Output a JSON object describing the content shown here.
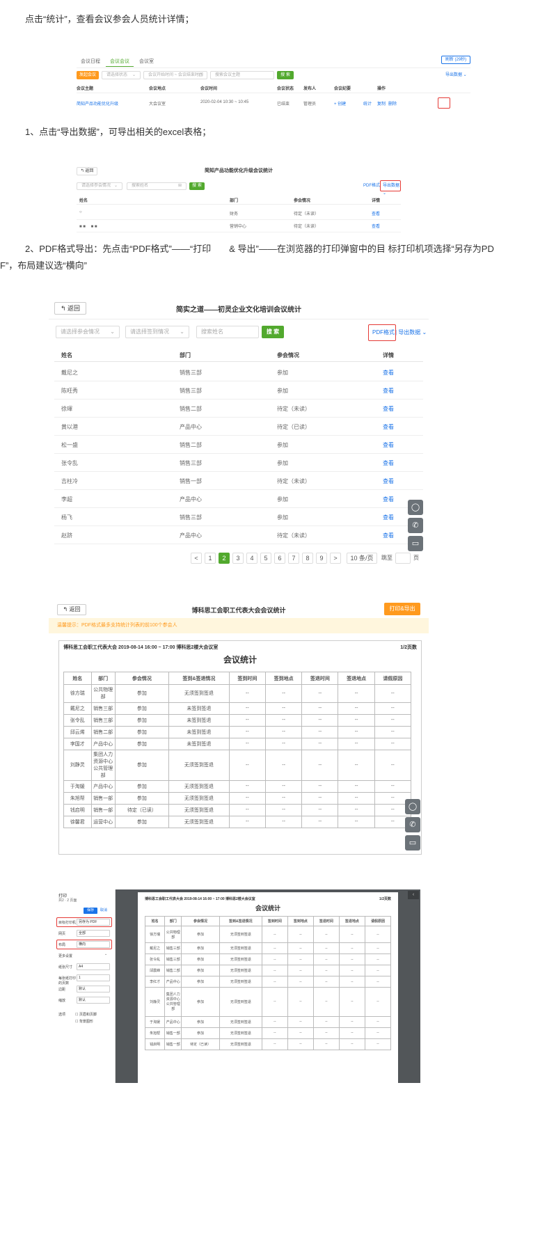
{
  "paragraphs": {
    "p1": "点击“统计”，查看会议参会人员统计详情；",
    "p2": "1、点击“导出数据”，可导出相关的excel表格；",
    "p3a": "2、PDF格式导出：先点击“PDF格式”——“打印　　& 导出”——在浏览器的打印弹窗中的目 标打印机项选择“另存为PD",
    "p3b": "F”，布局建议选“横向”"
  },
  "shot1": {
    "tabs": [
      "会议日程",
      "会议会议",
      "会议室"
    ],
    "refresh": "刷新 (29秒)",
    "add_btn": "发起会议",
    "status_placeholder": "请选择状态",
    "date_placeholder": "会议开始时间 ~ 会议结束时间",
    "search_placeholder": "搜索会议主题",
    "search_btn": "搜 索",
    "export": "导出数据",
    "headers": [
      "会议主题",
      "会议地点",
      "会议时间",
      "会议状态",
      "发布人",
      "会议纪要",
      "操作"
    ],
    "row": {
      "topic": "简知产品功能优化升级",
      "place": "大会议室",
      "time": "2020-02-04 10:30 ~ 10:45",
      "status": "已结束",
      "publisher": "管理员",
      "minutes": "+ 创建",
      "op1": "统计",
      "op2": "复制",
      "op3": "删除"
    }
  },
  "shot2": {
    "back": "返回",
    "title": "简知产品功能优化升级会议统计",
    "sel1": "请选择参会情况",
    "search_placeholder": "搜索姓名",
    "search_btn": "搜 索",
    "pdf": "PDF格式",
    "export": "导出数据",
    "headers": [
      "姓名",
      "部门",
      "参会情况",
      "详情"
    ],
    "rows": [
      {
        "name": "○",
        "dept": "财务",
        "status": "待定（未读）",
        "detail": "查看"
      },
      {
        "name": "■ ■ 　■ ■",
        "dept": "营销中心",
        "status": "待定（未读）",
        "detail": "查看"
      }
    ]
  },
  "shot3": {
    "back": "返回",
    "title": "简实之道——初灵企业文化培训会议统计",
    "sel1": "请选择参会情况",
    "sel2": "请选择签到情况",
    "search_placeholder": "搜索姓名",
    "search_btn": "搜 索",
    "pdf": "PDF格式",
    "export": "导出数据",
    "headers": [
      "姓名",
      "部门",
      "参会情况",
      "详情"
    ],
    "rows": [
      {
        "name": "戴尼之",
        "dept": "销售三部",
        "status": "参加",
        "detail": "查看"
      },
      {
        "name": "陈旺秀",
        "dept": "销售三部",
        "status": "参加",
        "detail": "查看"
      },
      {
        "name": "徐琿",
        "dept": "销售二部",
        "status": "待定（未读）",
        "detail": "查看"
      },
      {
        "name": "黄以港",
        "dept": "产品中心",
        "status": "待定（已读）",
        "detail": "查看"
      },
      {
        "name": "松一盛",
        "dept": "销售二部",
        "status": "参加",
        "detail": "查看"
      },
      {
        "name": "张令乱",
        "dept": "销售三部",
        "status": "参加",
        "detail": "查看"
      },
      {
        "name": "吉柱冷",
        "dept": "销售一部",
        "status": "待定（未读）",
        "detail": "查看"
      },
      {
        "name": "李超",
        "dept": "产品中心",
        "status": "参加",
        "detail": "查看"
      },
      {
        "name": "杨飞",
        "dept": "销售三部",
        "status": "参加",
        "detail": "查看"
      },
      {
        "name": "赵跻",
        "dept": "产品中心",
        "status": "待定（未读）",
        "detail": "查看"
      }
    ],
    "pages": [
      "1",
      "2",
      "3",
      "4",
      "5",
      "6",
      "7",
      "8",
      "9"
    ],
    "prev": "<",
    "next": ">",
    "page_size": "10 条/页",
    "goto": "跳至",
    "page_unit": "页"
  },
  "shot4": {
    "back": "返回",
    "title": "博科思工会职工代表大会会议统计",
    "print_btn": "打印&导出",
    "notice": "温馨提示：PDF格式最多支持统计列表的前100个参会人",
    "meta": "博科思工会职工代表大会 2019-08-14 16:00 ~ 17:00 博科思2楼大会议室",
    "pageinfo": "1/2页数",
    "table_title": "会议统计",
    "headers": [
      "姓名",
      "部门",
      "参会情况",
      "签到&签退情况",
      "签到时间",
      "签到地点",
      "签退时间",
      "签退地点",
      "请假原因"
    ],
    "rows": [
      {
        "name": "徐方瑞",
        "dept": "公共物理部",
        "status": "参加",
        "sign": "无须签到签退",
        "c5": "--",
        "c6": "--",
        "c7": "--",
        "c8": "--",
        "c9": "--"
      },
      {
        "name": "戴尼之",
        "dept": "销售三部",
        "status": "参加",
        "sign": "未签到签退",
        "c5": "--",
        "c6": "--",
        "c7": "--",
        "c8": "--",
        "c9": "--"
      },
      {
        "name": "张令乱",
        "dept": "销售三部",
        "status": "参加",
        "sign": "未签到签退",
        "c5": "--",
        "c6": "--",
        "c7": "--",
        "c8": "--",
        "c9": "--"
      },
      {
        "name": "邱云烯",
        "dept": "销售二部",
        "status": "参加",
        "sign": "未签到签退",
        "c5": "--",
        "c6": "--",
        "c7": "--",
        "c8": "--",
        "c9": "--"
      },
      {
        "name": "李国才",
        "dept": "产品中心",
        "status": "参加",
        "sign": "未签到签退",
        "c5": "--",
        "c6": "--",
        "c7": "--",
        "c8": "--",
        "c9": "--"
      },
      {
        "name": "刘静灵",
        "dept": "集团人力资源中心公共管理部",
        "status": "参加",
        "sign": "无须签到签退",
        "c5": "--",
        "c6": "--",
        "c7": "--",
        "c8": "--",
        "c9": "--"
      },
      {
        "name": "于淘媛",
        "dept": "产品中心",
        "status": "参加",
        "sign": "无须签到签退",
        "c5": "--",
        "c6": "--",
        "c7": "--",
        "c8": "--",
        "c9": "--"
      },
      {
        "name": "朱旭帮",
        "dept": "销售一部",
        "status": "参加",
        "sign": "无须签到签退",
        "c5": "--",
        "c6": "--",
        "c7": "--",
        "c8": "--",
        "c9": "--"
      },
      {
        "name": "钱启明",
        "dept": "销售一部",
        "status": "待定（已读）",
        "sign": "无须签到签退",
        "c5": "--",
        "c6": "--",
        "c7": "--",
        "c8": "--",
        "c9": "--"
      },
      {
        "name": "徐馨君",
        "dept": "运营中心",
        "status": "参加",
        "sign": "无须签到签退",
        "c5": "--",
        "c6": "--",
        "c7": "--",
        "c8": "--",
        "c9": "--"
      }
    ]
  },
  "shot5": {
    "panel_title": "打印",
    "panel_sub": "共2 · 2 页面",
    "save_btn": "保存",
    "cancel_btn": "取消",
    "fields": [
      {
        "label": "目标打印机",
        "value": "另存为 PDF"
      },
      {
        "label": "网页",
        "value": "全部"
      },
      {
        "label": "布局",
        "value": "横向"
      },
      {
        "label": "更多设置",
        "value": ""
      },
      {
        "label": "纸张尺寸",
        "value": "A4"
      },
      {
        "label": "每张纸打印的页数",
        "value": "1"
      },
      {
        "label": "边距",
        "value": "默认"
      },
      {
        "label": "缩放",
        "value": "默认"
      }
    ],
    "options_label": "选项",
    "option1": "页眉和页脚",
    "option2": "背景图形",
    "meta": "博科思工会职工代表大会 2019-08-14 16:00 ~ 17:00 博科思2楼大会议室",
    "pageinfo": "1/2页数",
    "table_title": "会议统计",
    "headers": [
      "姓名",
      "部门",
      "参会情况",
      "签到&签退情况",
      "签到时间",
      "签到地点",
      "签退时间",
      "签退地点",
      "请假原因"
    ],
    "rows": [
      {
        "name": "徐方瑞",
        "dept": "公共物理部",
        "status": "参加",
        "sign": "无须签到签退",
        "c5": "--",
        "c6": "--",
        "c7": "--",
        "c8": "--",
        "c9": "--"
      },
      {
        "name": "戴尼之",
        "dept": "销售三部",
        "status": "参加",
        "sign": "无须签到签退",
        "c5": "--",
        "c6": "--",
        "c7": "--",
        "c8": "--",
        "c9": "--"
      },
      {
        "name": "张令乱",
        "dept": "销售三部",
        "status": "参加",
        "sign": "无须签到签退",
        "c5": "--",
        "c6": "--",
        "c7": "--",
        "c8": "--",
        "c9": "--"
      },
      {
        "name": "邱震峰",
        "dept": "销售二部",
        "status": "参加",
        "sign": "无须签到签退",
        "c5": "--",
        "c6": "--",
        "c7": "--",
        "c8": "--",
        "c9": "--"
      },
      {
        "name": "李红才",
        "dept": "产品中心",
        "status": "参加",
        "sign": "无须签到签退",
        "c5": "--",
        "c6": "--",
        "c7": "--",
        "c8": "--",
        "c9": "--"
      },
      {
        "name": "刘静灵",
        "dept": "集团人力资源中心公共管理部",
        "status": "参加",
        "sign": "无须签到签退",
        "c5": "--",
        "c6": "--",
        "c7": "--",
        "c8": "--",
        "c9": "--"
      },
      {
        "name": "于淘媛",
        "dept": "产品中心",
        "status": "参加",
        "sign": "无须签到签退",
        "c5": "--",
        "c6": "--",
        "c7": "--",
        "c8": "--",
        "c9": "--"
      },
      {
        "name": "朱旭帮",
        "dept": "销售一部",
        "status": "参加",
        "sign": "无须签到签退",
        "c5": "--",
        "c6": "--",
        "c7": "--",
        "c8": "--",
        "c9": "--"
      },
      {
        "name": "钱启明",
        "dept": "销售一部",
        "status": "待定（已读）",
        "sign": "无须签到签退",
        "c5": "--",
        "c6": "--",
        "c7": "--",
        "c8": "--",
        "c9": "--"
      }
    ]
  },
  "icons": {
    "back": "back-arrow-icon",
    "chat": "chat-icon",
    "phone": "phone-icon",
    "window": "window-icon",
    "calendar": "calendar-icon",
    "chevron": "chevron-down-icon",
    "search": "search-icon"
  },
  "colors": {
    "green": "#52a92e",
    "orange": "#ff9a1e",
    "blue": "#1a73e8",
    "red": "#e53935"
  }
}
